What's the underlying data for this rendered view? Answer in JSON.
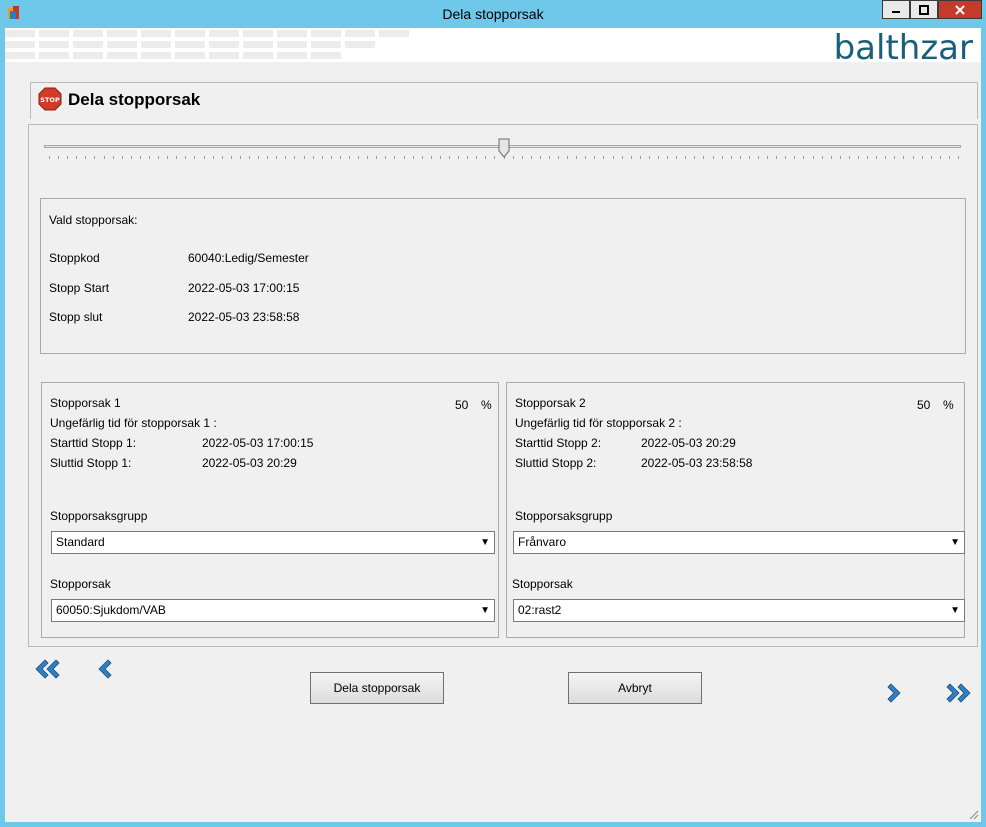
{
  "window": {
    "title": "Dela stopporsak"
  },
  "brand": {
    "name": "balthzar"
  },
  "page": {
    "title": "Dela stopporsak"
  },
  "slider": {
    "position_fraction": 0.5
  },
  "selected": {
    "heading": "Vald stopporsak:",
    "rows": [
      {
        "label": "Stoppkod",
        "value": "60040:Ledig/Semester"
      },
      {
        "label": "Stopp Start",
        "value": "2022-05-03 17:00:15"
      },
      {
        "label": "Stopp slut",
        "value": "2022-05-03 23:58:58"
      }
    ]
  },
  "part1": {
    "title": "Stopporsak 1",
    "percent": "50",
    "percent_unit": "%",
    "approx": "Ungefärlig tid för stopporsak 1 :",
    "start_label": "Starttid Stopp 1:",
    "start_value": "2022-05-03 17:00:15",
    "end_label": "Sluttid Stopp 1:",
    "end_value": "2022-05-03 20:29",
    "group_label": "Stopporsaksgrupp",
    "group_value": "Standard",
    "reason_label": "Stopporsak",
    "reason_value": "60050:Sjukdom/VAB"
  },
  "part2": {
    "title": "Stopporsak 2",
    "percent": "50",
    "percent_unit": "%",
    "approx": "Ungefärlig tid för stopporsak 2 :",
    "start_label": "Starttid Stopp 2:",
    "start_value": "2022-05-03 20:29",
    "end_label": "Sluttid Stopp 2:",
    "end_value": "2022-05-03 23:58:58",
    "group_label": "Stopporsaksgrupp",
    "group_value": "Frånvaro",
    "reason_label": "Stopporsak",
    "reason_value": "02:rast2"
  },
  "buttons": {
    "split": "Dela stopporsak",
    "cancel": "Avbryt"
  },
  "icons": {
    "first": "double-chevron-left-icon",
    "prev": "chevron-left-icon",
    "next": "chevron-right-icon",
    "last": "double-chevron-right-icon",
    "stop": "stop-sign-icon"
  },
  "colors": {
    "titlebar": "#6fc8ea",
    "brand": "#1a5f7a",
    "close": "#c7392b",
    "stop": "#d23a2a",
    "nav": "#2f7fc1"
  }
}
